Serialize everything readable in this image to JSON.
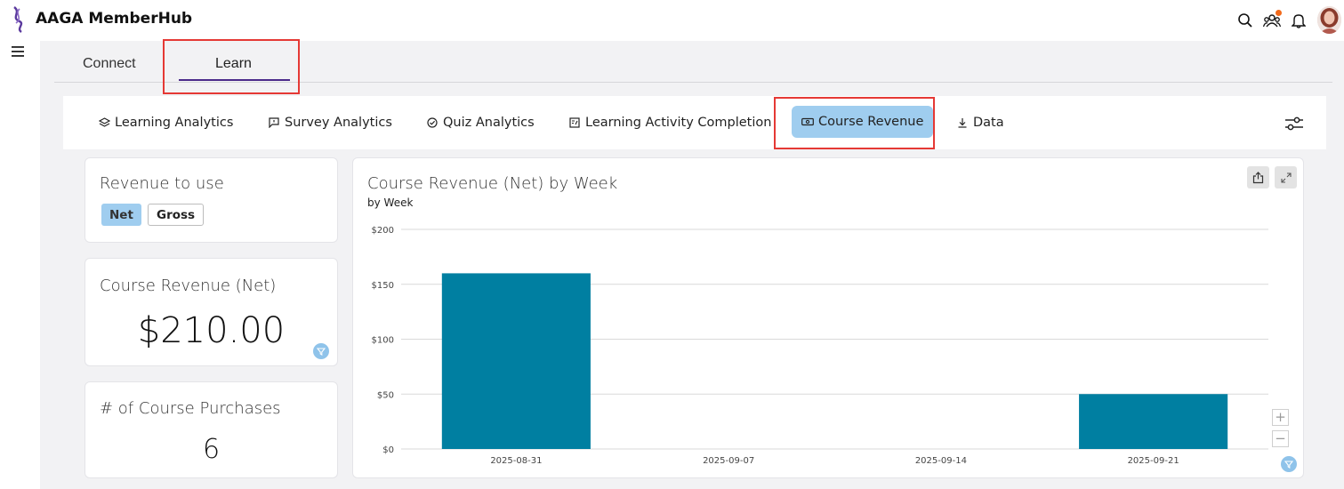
{
  "app": {
    "title": "AAGA MemberHub"
  },
  "header": {
    "icons": [
      "search-icon",
      "community-icon",
      "bell-icon"
    ],
    "notification_color": "#f26a1b"
  },
  "tabs": [
    {
      "label": "Connect",
      "active": false
    },
    {
      "label": "Learn",
      "active": true
    }
  ],
  "subnav": {
    "items": [
      {
        "label": "Learning Analytics",
        "icon": "layers-icon"
      },
      {
        "label": "Survey Analytics",
        "icon": "survey-icon"
      },
      {
        "label": "Quiz Analytics",
        "icon": "check-circle-icon"
      },
      {
        "label": "Learning Activity Completion",
        "icon": "completion-icon"
      },
      {
        "label": "Course Revenue",
        "icon": "money-icon",
        "active": true
      },
      {
        "label": "Data",
        "icon": "download-icon"
      }
    ],
    "settings_icon": "sliders-icon"
  },
  "cards": {
    "revenue_to_use": {
      "title": "Revenue to use",
      "options": [
        "Net",
        "Gross"
      ],
      "selected": "Net"
    },
    "course_revenue": {
      "title": "Course Revenue (Net)",
      "value": "$210.00"
    },
    "purchases": {
      "title": "# of Course Purchases",
      "value": "6"
    }
  },
  "chart": {
    "title": "Course Revenue (Net) by Week",
    "subtitle": "by Week"
  },
  "colors": {
    "accent": "#4b2a8a",
    "pill": "#9fcdef",
    "bar": "#007fa1",
    "highlight": "#e53935"
  },
  "chart_data": {
    "type": "bar",
    "title": "Course Revenue (Net) by Week",
    "subtitle": "by Week",
    "categories": [
      "2025-08-31",
      "2025-09-07",
      "2025-09-14",
      "2025-09-21"
    ],
    "values": [
      160,
      0,
      0,
      50
    ],
    "yticks": [
      "$0",
      "$50",
      "$100",
      "$150",
      "$200"
    ],
    "ylim": [
      0,
      200
    ],
    "grid": true,
    "color": "#007fa1"
  }
}
